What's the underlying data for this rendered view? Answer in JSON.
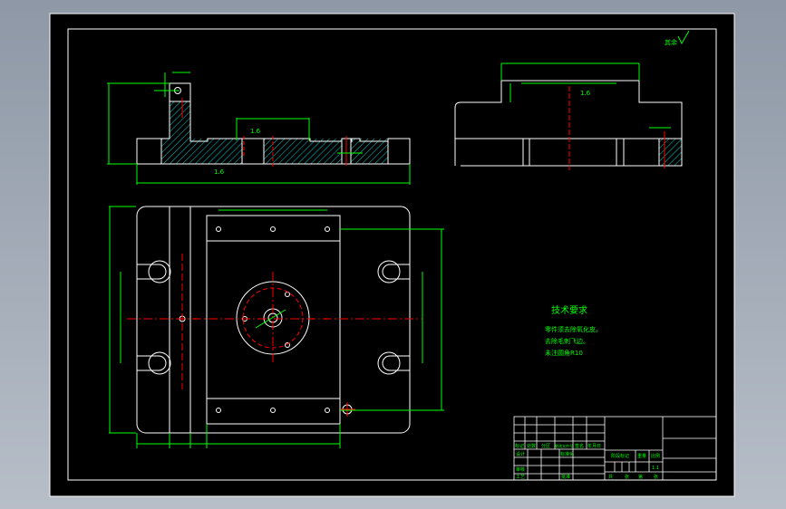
{
  "colors": {
    "background": "#000000",
    "outline": "#ffffff",
    "dimension": "#00ff00",
    "hatch": "#00ffff",
    "centerline": "#ff0000"
  },
  "tech_requirements": {
    "title": "技术要求",
    "items": [
      "零件须去除氧化皮。",
      "去除毛刺飞边。",
      "未注圆角R10"
    ]
  },
  "roughness": {
    "top_right": "其余",
    "front_top": "1.6",
    "front_bottom": "1.6",
    "right_top": "1.6"
  },
  "title_block": {
    "row_headers": [
      "标记",
      "处数",
      "分区",
      "更改文件号",
      "签名",
      "年月日"
    ],
    "design": "设计",
    "standardization": "标准化",
    "review": "审核",
    "process": "工艺",
    "approve": "批准",
    "stage_mark": "阶段标记",
    "weight": "重量",
    "scale": "比例",
    "scale_value": "1:1",
    "sheets": [
      "共",
      "张",
      "第",
      "张"
    ]
  }
}
